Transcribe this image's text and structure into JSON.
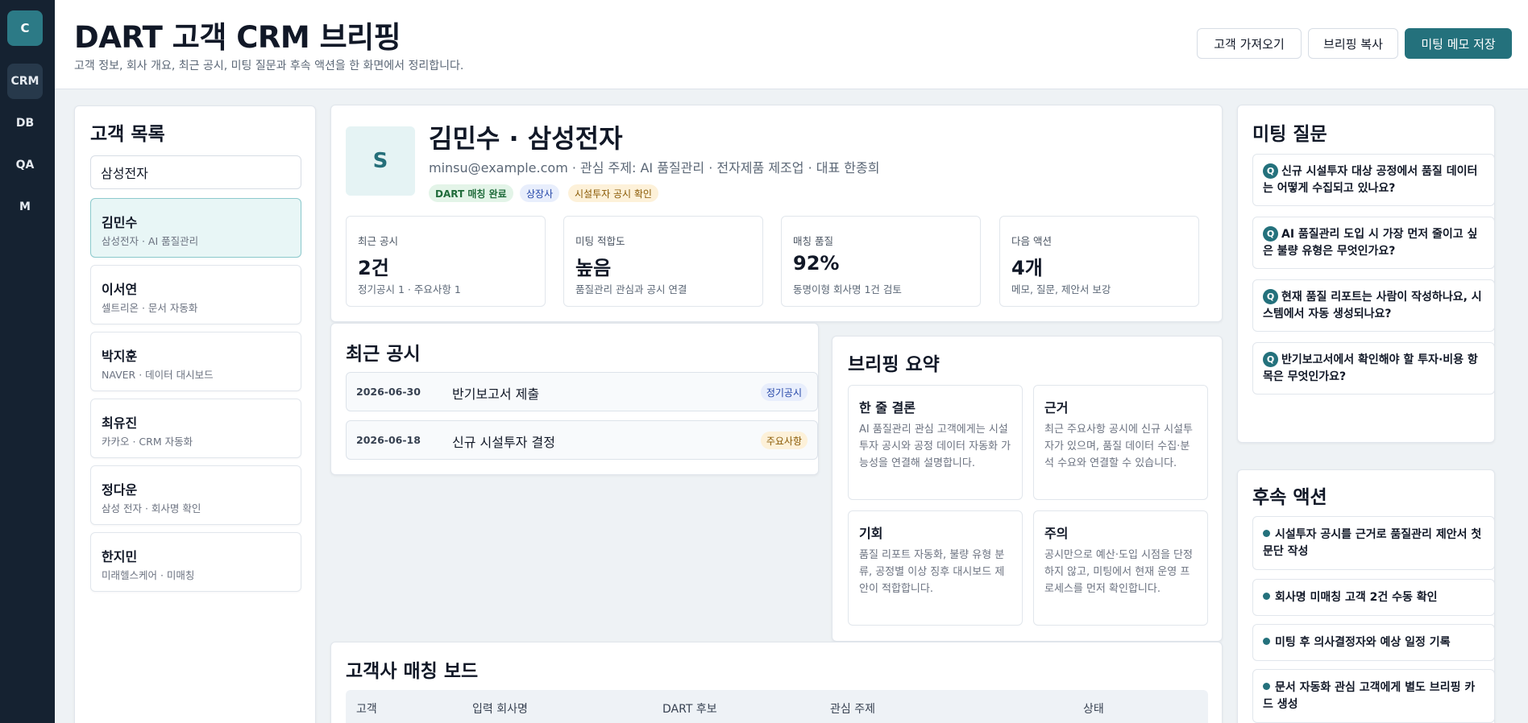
{
  "rail": {
    "logo": "C",
    "items": [
      "CRM",
      "DB",
      "QA",
      "M"
    ]
  },
  "header": {
    "title": "DART 고객 CRM 브리핑",
    "subtitle": "고객 정보, 회사 개요, 최근 공시, 미팅 질문과 후속 액션을 한 화면에서 정리합니다.",
    "buttons": {
      "import": "고객 가져오기",
      "copy": "브리핑 복사",
      "save": "미팅 메모 저장"
    }
  },
  "customer_list": {
    "title": "고객 목록",
    "search_value": "삼성전자",
    "items": [
      {
        "name": "김민수",
        "desc": "삼성전자 · AI 품질관리"
      },
      {
        "name": "이서연",
        "desc": "셀트리온 · 문서 자동화"
      },
      {
        "name": "박지훈",
        "desc": "NAVER · 데이터 대시보드"
      },
      {
        "name": "최유진",
        "desc": "카카오 · CRM 자동화"
      },
      {
        "name": "정다운",
        "desc": "삼성 전자 · 회사명 확인"
      },
      {
        "name": "한지민",
        "desc": "미래헬스케어 · 미매칭"
      }
    ]
  },
  "profile": {
    "avatar": "S",
    "name": "김민수 · 삼성전자",
    "meta": "minsu@example.com · 관심 주제: AI 품질관리 · 전자제품 제조업 · 대표 한종희",
    "badges": [
      "DART 매칭 완료",
      "상장사",
      "시설투자 공시 확인"
    ],
    "stats": [
      {
        "label": "최근 공시",
        "value": "2건",
        "note": "정기공시 1 · 주요사항 1"
      },
      {
        "label": "미팅 적합도",
        "value": "높음",
        "note": "품질관리 관심과 공시 연결"
      },
      {
        "label": "매칭 품질",
        "value": "92%",
        "note": "동명이형 회사명 1건 검토"
      },
      {
        "label": "다음 액션",
        "value": "4개",
        "note": "메모, 질문, 제안서 보강"
      }
    ]
  },
  "filings": {
    "title": "최근 공시",
    "rows": [
      {
        "date": "2026-06-30",
        "title": "반기보고서 제출",
        "tag": "정기공시"
      },
      {
        "date": "2026-06-18",
        "title": "신규 시설투자 결정",
        "tag": "주요사항"
      }
    ]
  },
  "briefing": {
    "title": "브리핑 요약",
    "boxes": [
      {
        "title": "한 줄 결론",
        "body": "AI 품질관리 관심 고객에게는 시설투자 공시와 공정 데이터 자동화 가능성을 연결해 설명합니다."
      },
      {
        "title": "근거",
        "body": "최근 주요사항 공시에 신규 시설투자가 있으며, 품질 데이터 수집·분석 수요와 연결할 수 있습니다."
      },
      {
        "title": "기회",
        "body": "품질 리포트 자동화, 불량 유형 분류, 공정별 이상 징후 대시보드 제안이 적합합니다."
      },
      {
        "title": "주의",
        "body": "공시만으로 예산·도입 시점을 단정하지 않고, 미팅에서 현재 운영 프로세스를 먼저 확인합니다."
      }
    ]
  },
  "questions": {
    "title": "미팅 질문",
    "icon_letter": "Q",
    "items": [
      "신규 시설투자 대상 공정에서 품질 데이터는 어떻게 수집되고 있나요?",
      "AI 품질관리 도입 시 가장 먼저 줄이고 싶은 불량 유형은 무엇인가요?",
      "현재 품질 리포트는 사람이 작성하나요, 시스템에서 자동 생성되나요?",
      "반기보고서에서 확인해야 할 투자·비용 항목은 무엇인가요?"
    ]
  },
  "followups": {
    "title": "후속 액션",
    "items": [
      "시설투자 공시를 근거로 품질관리 제안서 첫 문단 작성",
      "회사명 미매칭 고객 2건 수동 확인",
      "미팅 후 의사결정자와 예상 일정 기록",
      "문서 자동화 관심 고객에게 별도 브리핑 카드 생성"
    ]
  },
  "matching": {
    "title": "고객사 매칭 보드",
    "columns": [
      "고객",
      "입력 회사명",
      "DART 후보",
      "관심 주제",
      "상태"
    ]
  },
  "colors": {
    "accent": "#24717c",
    "rail": "#152231",
    "background": "#eef2f5"
  }
}
